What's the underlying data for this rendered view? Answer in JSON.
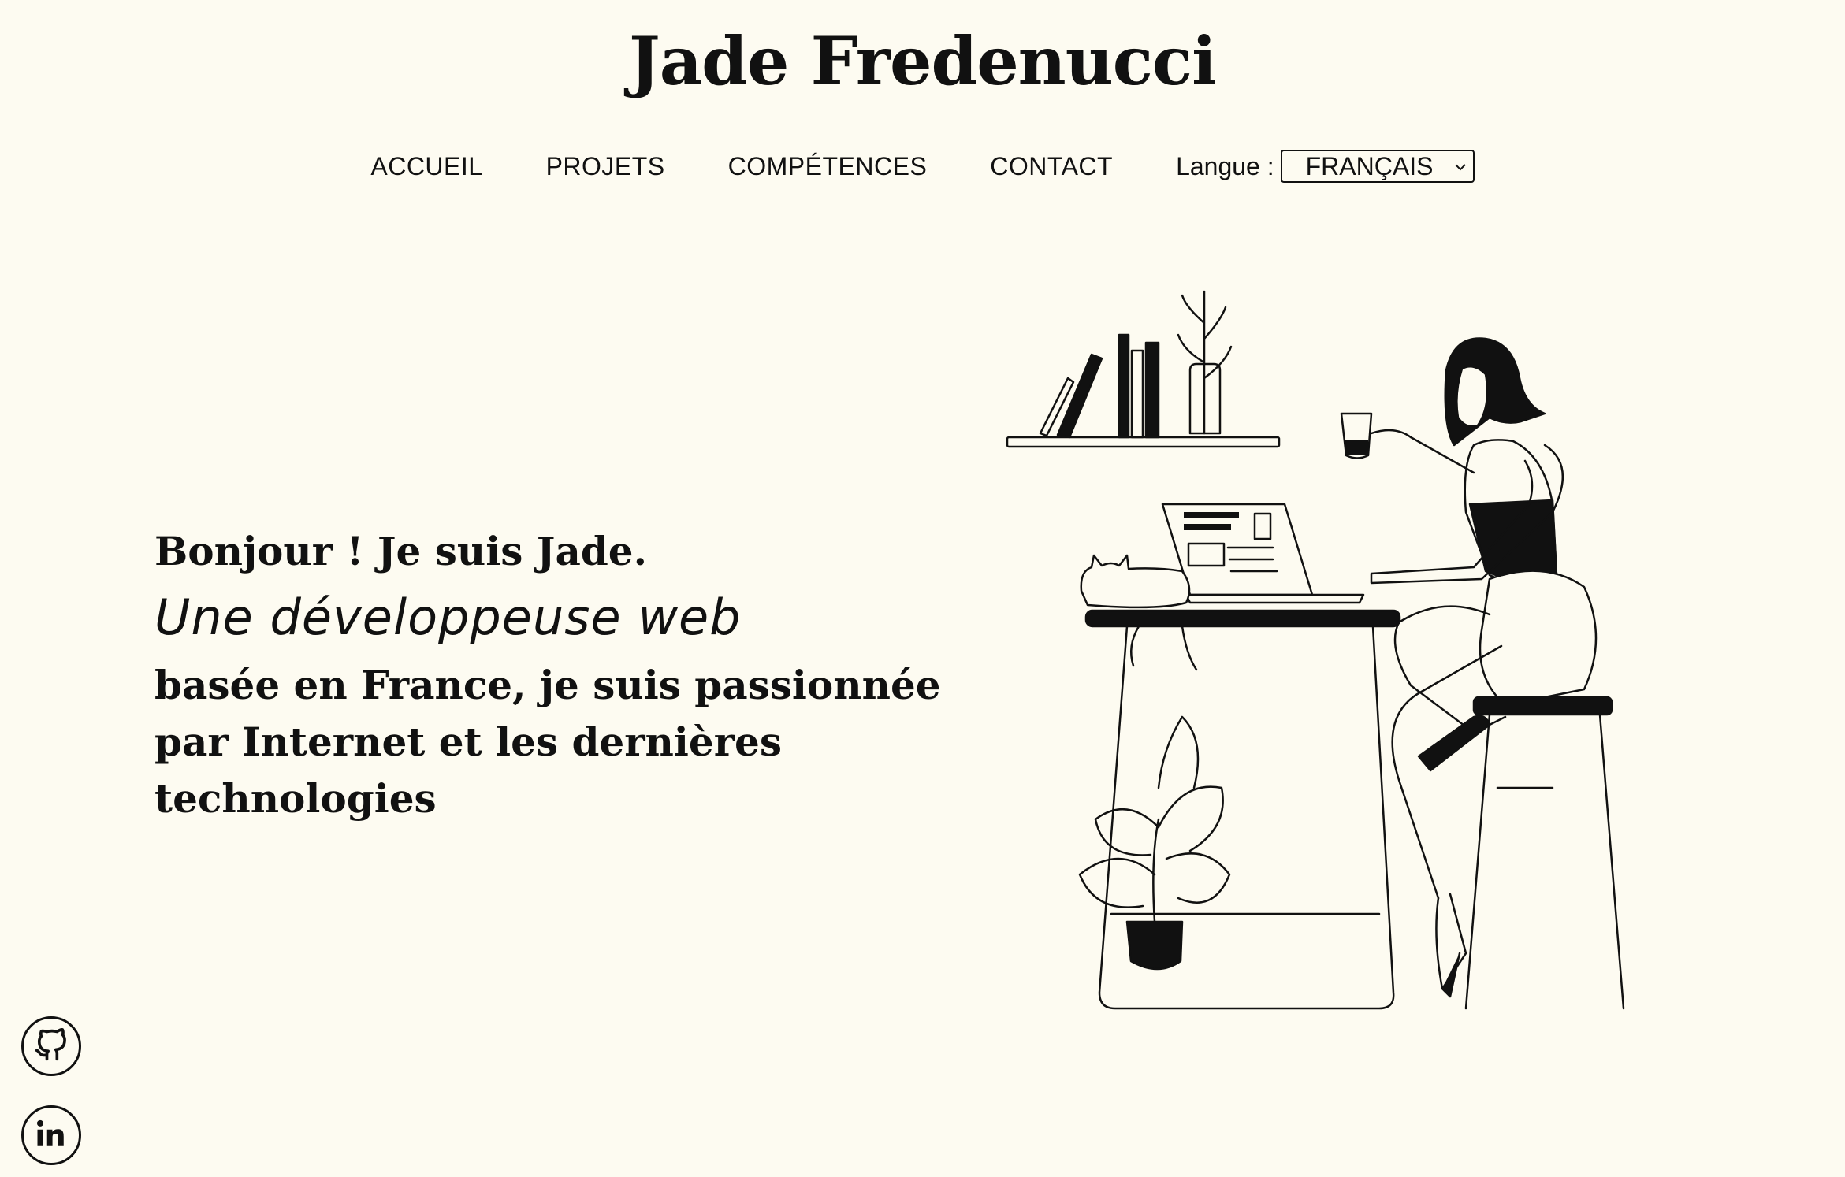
{
  "header": {
    "title": "Jade Fredenucci"
  },
  "nav": {
    "items": [
      "ACCUEIL",
      "PROJETS",
      "COMPÉTENCES",
      "CONTACT"
    ],
    "language_label": "Langue :",
    "language_selected": "FRANÇAIS"
  },
  "hero": {
    "greeting": "Bonjour ! Je suis Jade.",
    "role": "Une développeuse web",
    "description": "basée en France, je suis passionnée par Internet et les dernières technologies"
  },
  "social": [
    {
      "icon": "github-icon"
    },
    {
      "icon": "linkedin-icon"
    }
  ],
  "colors": {
    "background": "#fdfbf1",
    "text": "#111111"
  }
}
